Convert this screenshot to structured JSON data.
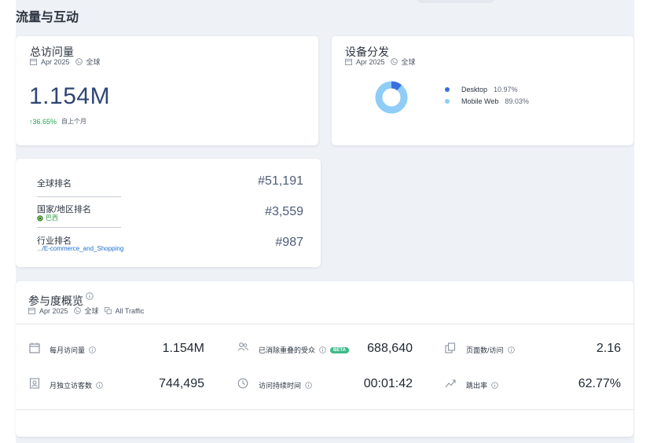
{
  "page": {
    "title": "流量与互动"
  },
  "total_visits": {
    "title": "总访问量",
    "date": "Apr 2025",
    "region": "全球",
    "value": "1.154M",
    "change_pct": "↑36.65%",
    "change_label": "自上个月"
  },
  "device_distribution": {
    "title": "设备分发",
    "date": "Apr 2025",
    "region": "全球",
    "items": [
      {
        "name": "Desktop",
        "value": "10.97%",
        "share": 10.97,
        "color": "#3b6fe0"
      },
      {
        "name": "Mobile Web",
        "value": "89.03%",
        "share": 89.03,
        "color": "#8fcdf7"
      }
    ]
  },
  "rankings": {
    "global": {
      "label": "全球排名",
      "value": "#51,191"
    },
    "country": {
      "label": "国家/地区排名",
      "sub": "巴西",
      "value": "#3,559"
    },
    "industry": {
      "label": "行业排名",
      "sub": ".../E-commerce_and_Shopping",
      "value": "#987"
    }
  },
  "engagement": {
    "title": "参与度概览",
    "date": "Apr 2025",
    "region": "全球",
    "traffic": "All Traffic",
    "beta": "BETA",
    "metrics": [
      {
        "label": "每月访问量",
        "value": "1.154M",
        "icon": "calendar-icon"
      },
      {
        "label": "已消除重叠的受众",
        "value": "688,640",
        "icon": "users-icon"
      },
      {
        "label": "页面数/访问",
        "value": "2.16",
        "icon": "pages-icon"
      },
      {
        "label": "月独立访客数",
        "value": "744,495",
        "icon": "id-card-icon"
      },
      {
        "label": "访问持续时间",
        "value": "00:01:42",
        "icon": "clock-icon"
      },
      {
        "label": "跳出率",
        "value": "62.77%",
        "icon": "trend-icon"
      }
    ]
  },
  "colors": {
    "accent": "#2f4675",
    "positive": "#23a455",
    "link": "#1a6fd6",
    "beta": "#3fb988"
  }
}
